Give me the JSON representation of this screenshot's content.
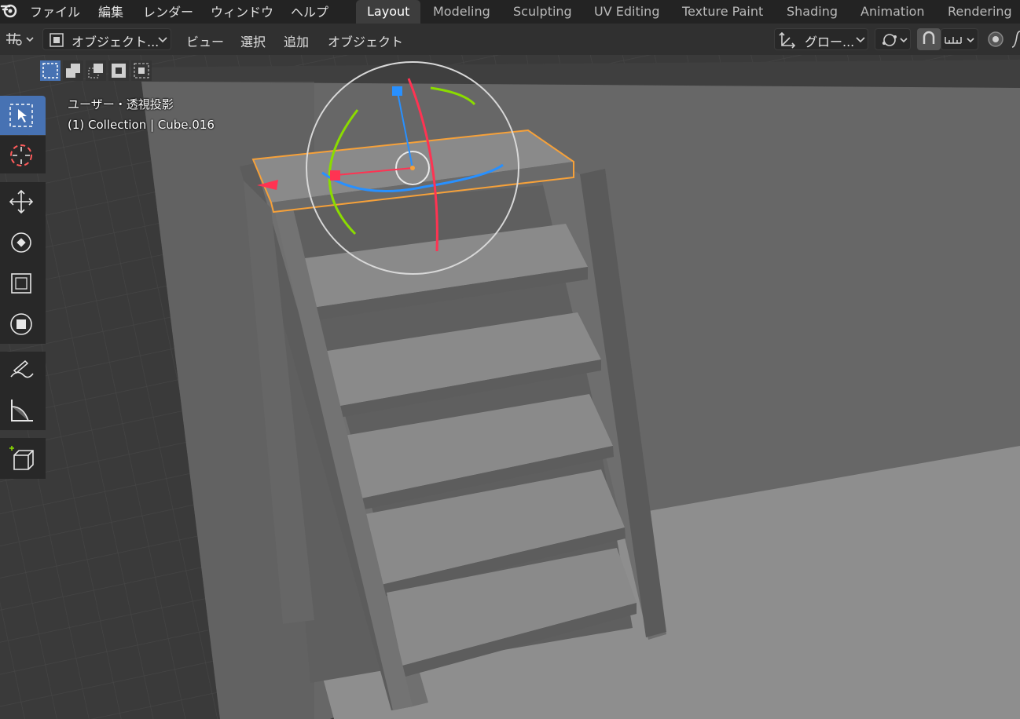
{
  "menu": {
    "items": [
      "ファイル",
      "編集",
      "レンダー",
      "ウィンドウ",
      "ヘルプ"
    ]
  },
  "workspaces": {
    "tabs": [
      "Layout",
      "Modeling",
      "Sculpting",
      "UV Editing",
      "Texture Paint",
      "Shading",
      "Animation",
      "Rendering"
    ],
    "active": "Layout"
  },
  "header": {
    "mode_label": "オブジェクト...",
    "menus": [
      "ビュー",
      "選択",
      "追加",
      "オブジェクト"
    ],
    "orientation_label": "グロー..."
  },
  "viewport": {
    "view_name": "ユーザー・透視投影",
    "object_info": "(1) Collection | Cube.016",
    "selection_outline_color": "#f6a13a",
    "gizmo_colors": {
      "x": "#ff3352",
      "y": "#8bdc00",
      "z": "#2890ff"
    }
  },
  "toolbar": {
    "tools": [
      "select-box",
      "cursor",
      "move",
      "rotate",
      "scale",
      "transform",
      "annotate",
      "measure",
      "add-cube"
    ],
    "active": "select-box"
  },
  "icons": {
    "logo": "blender-logo-icon",
    "editor_type": "editor-type-icon",
    "proportional": "proportional-editing-icon",
    "snap": "snap-icon"
  }
}
